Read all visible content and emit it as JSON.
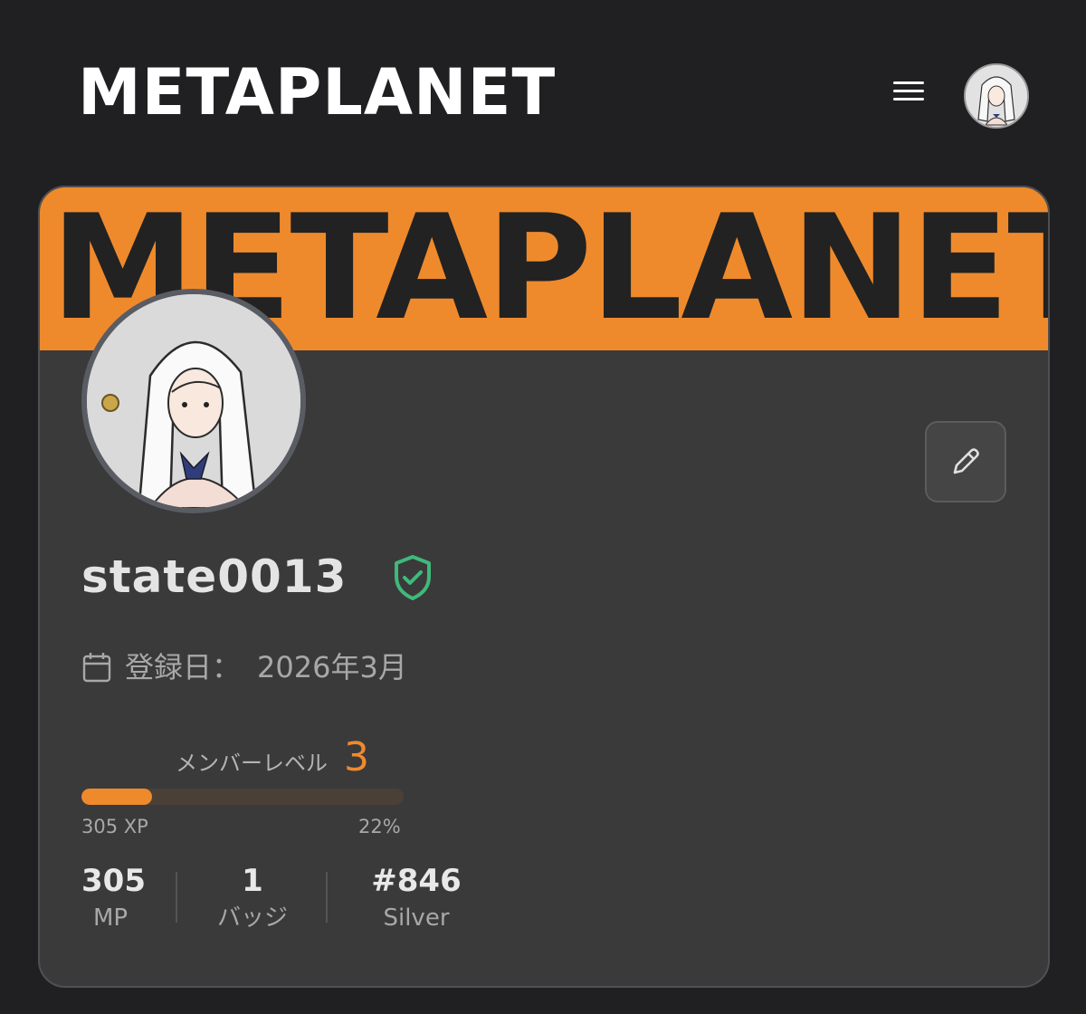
{
  "header": {
    "brand": "METAPLANET",
    "menu_icon": "hamburger-icon",
    "avatar_icon": "user-avatar"
  },
  "profile": {
    "banner_text": "METAPLANET",
    "username": "state0013",
    "verified_icon": "shield-check-icon",
    "edit_icon": "pencil-icon",
    "joined_label": "登録日：",
    "joined_value": "2026年3月",
    "level_label": "メンバーレベル",
    "level": "3",
    "xp": "305 XP",
    "progress_percent": "22%",
    "progress": 0.22
  },
  "stats": [
    {
      "value": "305",
      "label": "MP"
    },
    {
      "value": "1",
      "label": "バッジ"
    },
    {
      "value": "#846",
      "label": "Silver"
    }
  ],
  "colors": {
    "accent": "#ef8a2c",
    "verified": "#3fb97a",
    "background": "#202022",
    "card": "#3a3a3b"
  }
}
